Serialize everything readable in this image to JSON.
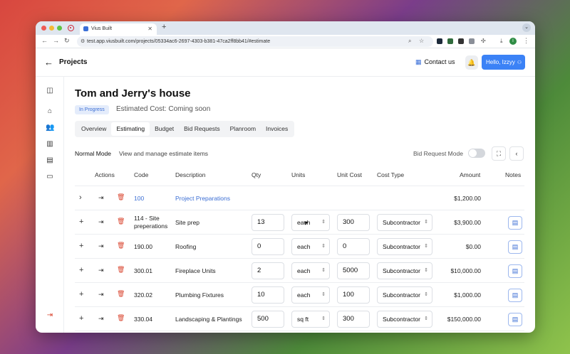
{
  "browser": {
    "tab_title": "Vius Built",
    "url": "test.app.viusbuilt.com/projects/05334ac6-2697-4303-b381-47ca2ff8bb41/#estimate",
    "profile_initial": "I"
  },
  "header": {
    "title": "Projects",
    "contact_label": "Contact us",
    "user_button": "Hello, Izzyy"
  },
  "project": {
    "name": "Tom and Jerry's house",
    "status": "In Progress",
    "estimated_cost": "Estimated Cost: Coming soon"
  },
  "tabs": [
    {
      "label": "Overview"
    },
    {
      "label": "Estimating"
    },
    {
      "label": "Budget"
    },
    {
      "label": "Bid Requests"
    },
    {
      "label": "Planroom"
    },
    {
      "label": "Invoices"
    }
  ],
  "toolbar": {
    "mode": "Normal Mode",
    "mode_description": "View and manage estimate items",
    "bid_request_mode": "Bid Request Mode"
  },
  "table": {
    "columns": {
      "actions": "Actions",
      "code": "Code",
      "description": "Description",
      "qty": "Qty",
      "units": "Units",
      "unit_cost": "Unit Cost",
      "cost_type": "Cost Type",
      "amount": "Amount",
      "notes": "Notes"
    },
    "group": {
      "code": "100",
      "description": "Project Preparations",
      "amount": "$1,200.00"
    },
    "rows": [
      {
        "code": "114 - Site preperations",
        "description": "Site prep",
        "qty": "13",
        "unit": "each",
        "unit_cost": "300",
        "cost_type": "Subcontractor",
        "amount": "$3,900.00"
      },
      {
        "code": "190.00",
        "description": "Roofing",
        "qty": "0",
        "unit": "each",
        "unit_cost": "0",
        "cost_type": "Subcontractor",
        "amount": "$0.00"
      },
      {
        "code": "300.01",
        "description": "Fireplace Units",
        "qty": "2",
        "unit": "each",
        "unit_cost": "5000",
        "cost_type": "Subcontractor",
        "amount": "$10,000.00"
      },
      {
        "code": "320.02",
        "description": "Plumbing Fixtures",
        "qty": "10",
        "unit": "each",
        "unit_cost": "100",
        "cost_type": "Subcontractor",
        "amount": "$1,000.00"
      },
      {
        "code": "330.04",
        "description": "Landscaping & Plantings",
        "qty": "500",
        "unit": "sq ft",
        "unit_cost": "300",
        "cost_type": "Subcontractor",
        "amount": "$150,000.00"
      }
    ]
  },
  "colors": {
    "accent": "#3b82f6",
    "link": "#3b6ed4",
    "danger": "#d9452f",
    "badge_bg": "#e4ecfb"
  }
}
